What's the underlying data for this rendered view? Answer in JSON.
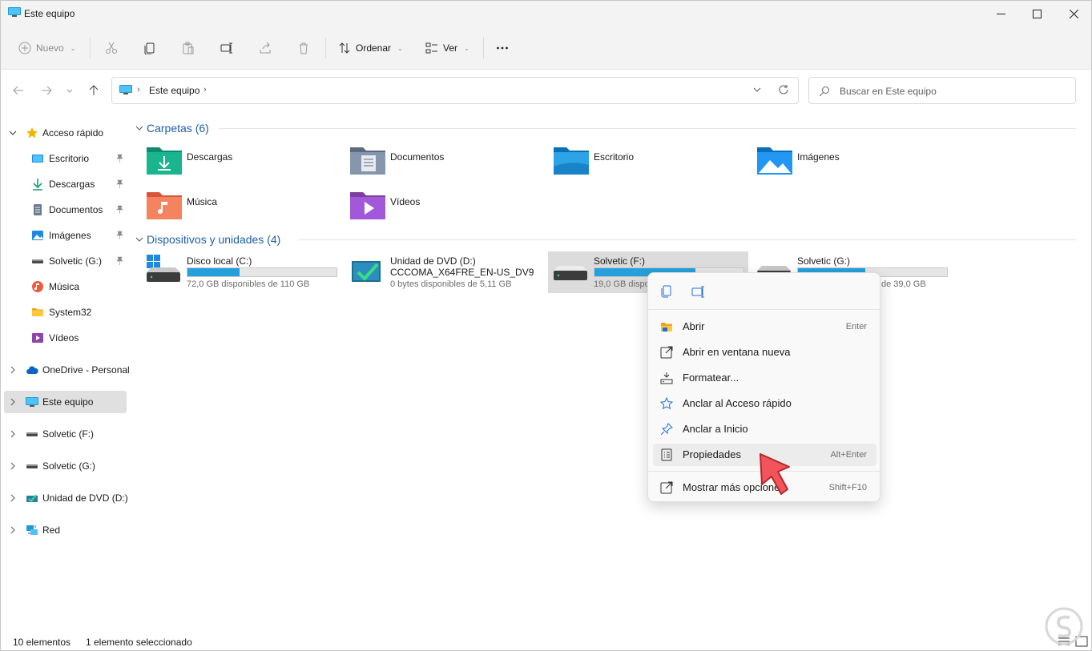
{
  "window": {
    "title": "Este equipo",
    "controls": [
      "minimize-icon",
      "maximize-icon",
      "close-icon"
    ]
  },
  "toolbar": {
    "new_label": "Nuevo",
    "sort_label": "Ordenar",
    "view_label": "Ver",
    "icons": [
      "cut-icon",
      "copy-icon",
      "paste-icon",
      "rename-icon",
      "share-icon",
      "delete-icon",
      "more-icon"
    ]
  },
  "address": {
    "crumb": "Este equipo"
  },
  "search": {
    "placeholder": "Buscar en Este equipo"
  },
  "sidebar": {
    "items": [
      {
        "label": "Acceso rápido",
        "icon": "star-icon",
        "expanded": true
      },
      {
        "label": "Escritorio",
        "icon": "desktop-icon",
        "pinned": true
      },
      {
        "label": "Descargas",
        "icon": "download-icon",
        "pinned": true
      },
      {
        "label": "Documentos",
        "icon": "document-icon",
        "pinned": true
      },
      {
        "label": "Imágenes",
        "icon": "pictures-icon",
        "pinned": true
      },
      {
        "label": "Solvetic (G:)",
        "icon": "drive-icon",
        "pinned": true
      },
      {
        "label": "Música",
        "icon": "music-icon"
      },
      {
        "label": "System32",
        "icon": "folder-icon"
      },
      {
        "label": "Vídeos",
        "icon": "video-icon"
      },
      {
        "label": "OneDrive - Personal",
        "icon": "cloud-icon"
      },
      {
        "label": "Este equipo",
        "icon": "pc-icon",
        "selected": true
      },
      {
        "label": "Solvetic (F:)",
        "icon": "drive-icon"
      },
      {
        "label": "Solvetic (G:)",
        "icon": "drive-icon"
      },
      {
        "label": "Unidad de DVD (D:)",
        "icon": "dvd-icon"
      },
      {
        "label": "Red",
        "icon": "network-icon"
      }
    ]
  },
  "main": {
    "folders_header": "Carpetas (6)",
    "folders": [
      {
        "label": "Descargas",
        "icon": "downloads-folder-icon"
      },
      {
        "label": "Documentos",
        "icon": "documents-folder-icon"
      },
      {
        "label": "Escritorio",
        "icon": "desktop-folder-icon"
      },
      {
        "label": "Imágenes",
        "icon": "pictures-folder-icon"
      },
      {
        "label": "Música",
        "icon": "music-folder-icon"
      },
      {
        "label": "Vídeos",
        "icon": "videos-folder-icon"
      }
    ],
    "devices_header": "Dispositivos y unidades (4)",
    "devices": [
      {
        "label": "Disco local (C:)",
        "sub": "72,0 GB disponibles de 110 GB",
        "used_fraction": 0.35,
        "icon": "windows-drive-icon"
      },
      {
        "label": "Unidad de DVD (D:)",
        "label2": "CCCOMA_X64FRE_EN-US_DV9",
        "sub": "0 bytes disponibles de 5,11 GB",
        "icon": "dvd-drive-icon"
      },
      {
        "label": "Solvetic (F:)",
        "sub": "19,0 GB dispo",
        "used_fraction": 0.68,
        "icon": "drive-icon",
        "selected": true
      },
      {
        "label": "Solvetic (G:)",
        "sub": "de 39,0 GB",
        "used_fraction": 0.45,
        "icon": "drive-icon"
      }
    ]
  },
  "context_menu": {
    "quick_icons": [
      "copy-icon",
      "rename-icon"
    ],
    "items": [
      {
        "label": "Abrir",
        "shortcut": "Enter",
        "icon": "open-folder-icon"
      },
      {
        "label": "Abrir en ventana nueva",
        "shortcut": "",
        "icon": "open-new-window-icon"
      },
      {
        "label": "Formatear...",
        "shortcut": "",
        "icon": "format-icon"
      },
      {
        "label": "Anclar al Acceso rápido",
        "shortcut": "",
        "icon": "star-outline-icon"
      },
      {
        "label": "Anclar a Inicio",
        "shortcut": "",
        "icon": "pin-icon"
      },
      {
        "label": "Propiedades",
        "shortcut": "Alt+Enter",
        "icon": "properties-icon",
        "hover": true
      },
      {
        "label": "Mostrar más opciones",
        "shortcut": "Shift+F10",
        "icon": "more-options-icon"
      }
    ]
  },
  "status": {
    "count": "10 elementos",
    "selection": "1 elemento seleccionado"
  },
  "colors": {
    "accent": "#1e5ea8",
    "progress": "#26a0da",
    "cursor": "#f2545b"
  }
}
